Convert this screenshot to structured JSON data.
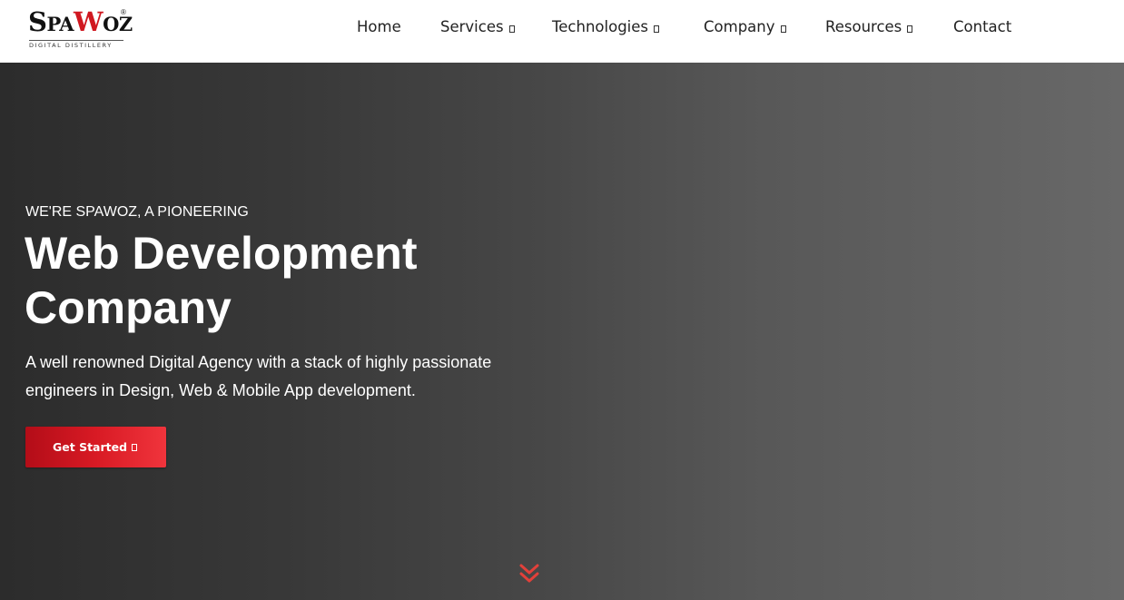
{
  "brand": {
    "logo_main_s": "S",
    "logo_main_pa": "PA",
    "logo_main_w": "W",
    "logo_main_oz": "OZ",
    "logo_reg": "®",
    "tagline": "DIGITAL DISTILLERY"
  },
  "nav": {
    "items": [
      {
        "label": "Home",
        "has_dropdown": false
      },
      {
        "label": "Services",
        "has_dropdown": true
      },
      {
        "label": "Technologies",
        "has_dropdown": true
      },
      {
        "label": "Company",
        "has_dropdown": true
      },
      {
        "label": "Resources",
        "has_dropdown": true
      },
      {
        "label": "Contact",
        "has_dropdown": false
      }
    ]
  },
  "hero": {
    "kicker": "WE'RE SPAWOZ, A PIONEERING",
    "title_line1": "Web Development",
    "title_line2": "Company",
    "description_line1": "A well renowned Digital Agency with a stack of highly passionate",
    "description_line2": "engineers in Design, Web & Mobile App development.",
    "cta_label": "Get Started",
    "cta_icon": "arrow-right-icon",
    "scroll_icon": "double-chevron-down-icon"
  },
  "colors": {
    "accent": "#d81a24",
    "accent_light": "#f0343c",
    "header_bg": "#ffffff",
    "hero_dark": "#2c2c2c",
    "hero_light": "#686868",
    "nav_text": "#222222",
    "scroll_arrow": "#e2403a"
  }
}
